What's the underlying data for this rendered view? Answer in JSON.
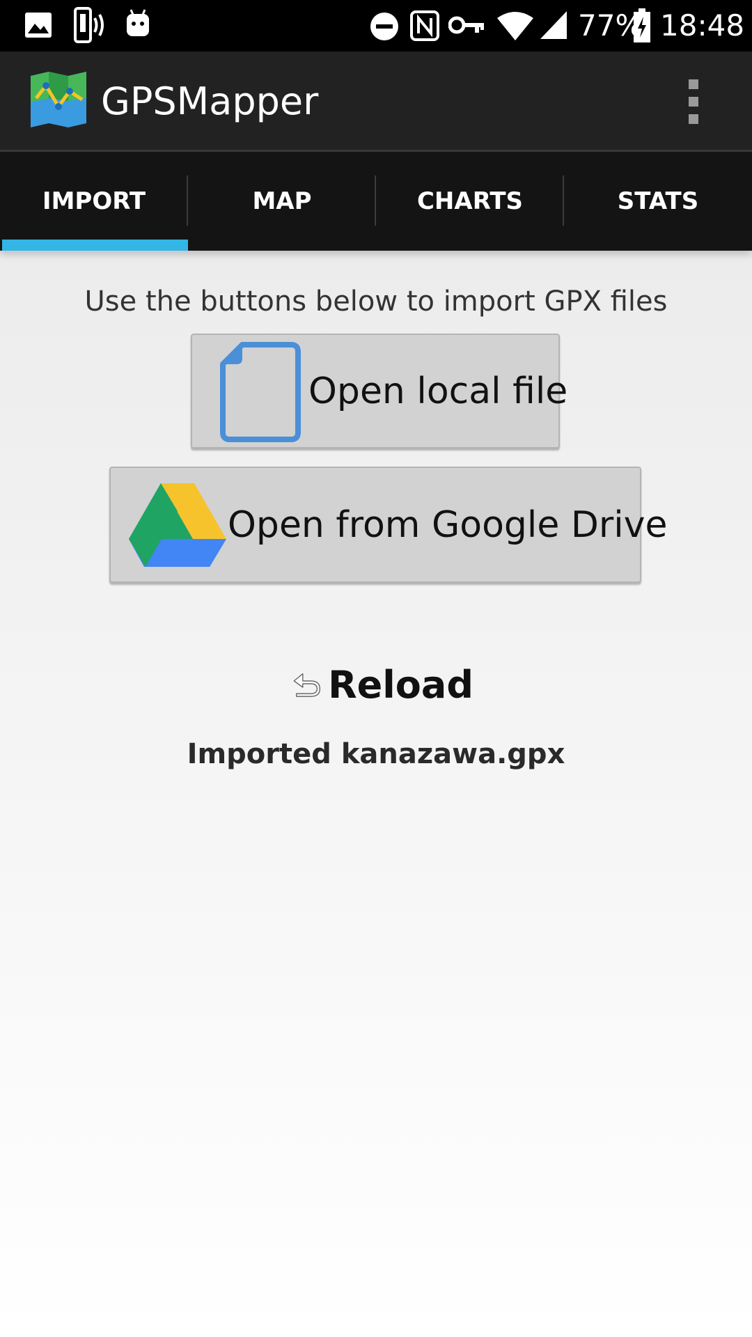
{
  "status_bar": {
    "battery": "77%",
    "time": "18:48"
  },
  "app": {
    "title": "GPSMapper"
  },
  "tabs": [
    {
      "label": "IMPORT",
      "selected": true
    },
    {
      "label": "MAP",
      "selected": false
    },
    {
      "label": "CHARTS",
      "selected": false
    },
    {
      "label": "STATS",
      "selected": false
    }
  ],
  "main": {
    "instruction": "Use the buttons below to import GPX files",
    "open_local_label": "Open local file",
    "open_drive_label": "Open from Google Drive",
    "reload_label": "Reload",
    "status_text": "Imported kanazawa.gpx"
  },
  "colors": {
    "tab_indicator": "#33b5e5",
    "app_bar": "#222222",
    "tab_bar": "#141414"
  },
  "icons": [
    "image-icon",
    "phone-vibrate-icon",
    "android-icon",
    "do-not-disturb-icon",
    "nfc-icon",
    "vpn-key-icon",
    "wifi-icon",
    "signal-icon",
    "battery-icon",
    "app-logo-icon",
    "overflow-menu-icon",
    "file-icon",
    "google-drive-icon",
    "undo-icon"
  ]
}
